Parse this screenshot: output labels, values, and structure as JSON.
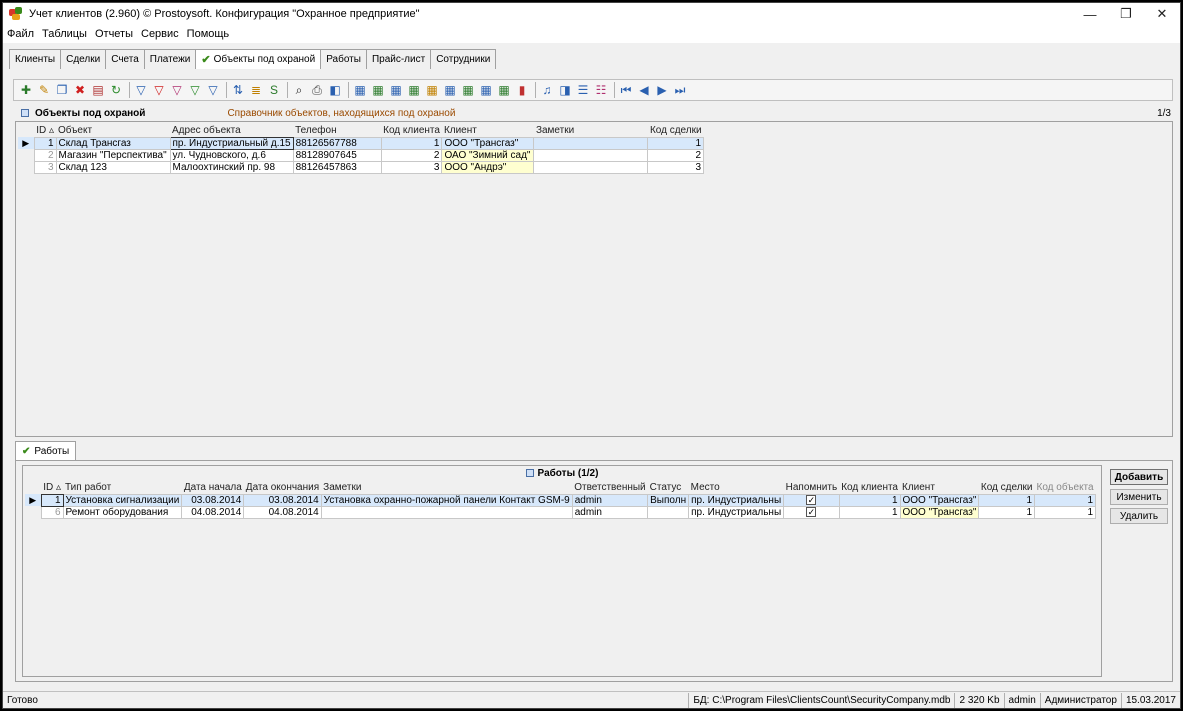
{
  "window": {
    "title": "Учет клиентов (2.960) © Prostoysoft. Конфигурация \"Охранное предприятие\"",
    "controls": [
      "—",
      "❐",
      "✕"
    ]
  },
  "menu": [
    "Файл",
    "Таблицы",
    "Отчеты",
    "Сервис",
    "Помощь"
  ],
  "tabs": [
    {
      "label": "Клиенты"
    },
    {
      "label": "Сделки"
    },
    {
      "label": "Счета"
    },
    {
      "label": "Платежи"
    },
    {
      "label": "Объекты под охраной",
      "active": true
    },
    {
      "label": "Работы"
    },
    {
      "label": "Прайс-лист"
    },
    {
      "label": "Сотрудники"
    }
  ],
  "toolbar_icons": [
    "add-record-icon",
    "edit-icon",
    "copy-icon",
    "delete-icon",
    "print-list-icon",
    "refresh-icon",
    "sep",
    "filter-icon",
    "filter-remove-icon",
    "filter-advanced-icon",
    "filter-field-icon",
    "filter-clear-icon",
    "sep",
    "sort-icon",
    "group-icon",
    "sql-icon",
    "sep",
    "find-icon",
    "print-icon",
    "preview-icon",
    "sep",
    "export-icon",
    "import-icon",
    "report-icon",
    "report2-icon",
    "report3-icon",
    "report4-icon",
    "report5-icon",
    "report6-icon",
    "report7-icon",
    "chart-icon",
    "sep",
    "note-icon",
    "attach-icon",
    "list-icon",
    "memo-icon",
    "sep",
    "first-icon",
    "prev-icon",
    "next-icon",
    "last-icon"
  ],
  "objects_panel": {
    "title": "Объекты под охраной",
    "description": "Справочник объектов, находящихся под охраной",
    "counter": "1/3",
    "columns": [
      "ID",
      "Объект",
      "Адрес объекта",
      "Телефон",
      "Код клиента",
      "Клиент",
      "Заметки",
      "Код сделки"
    ],
    "rows": [
      {
        "id": "1",
        "object": "Склад Трансгаз",
        "address": "пр. Индустриальный д.15",
        "phone": "88126567788",
        "client_code": "1",
        "client": "ООО \"Трансгаз\"",
        "notes": "",
        "deal_code": "1"
      },
      {
        "id": "2",
        "object": "Магазин \"Перспектива\"",
        "address": "ул. Чудновского, д.6",
        "phone": "88128907645",
        "client_code": "2",
        "client": "ОАО \"Зимний сад\"",
        "notes": "",
        "deal_code": "2"
      },
      {
        "id": "3",
        "object": "Склад 123",
        "address": "Малоохтинский пр. 98",
        "phone": "88126457863",
        "client_code": "3",
        "client": "ООО \"Андрэ\"",
        "notes": "",
        "deal_code": "3"
      }
    ]
  },
  "works_tab": {
    "label": "Работы"
  },
  "works_panel": {
    "title": "Работы (1/2)",
    "columns": [
      "ID",
      "Тип работ",
      "Дата начала",
      "Дата окончания",
      "Заметки",
      "Ответственный",
      "Статус",
      "Место",
      "Напомнить",
      "Код клиента",
      "Клиент",
      "Код сделки",
      "Код объекта"
    ],
    "rows": [
      {
        "id": "1",
        "type": "Установка сигнализации",
        "start": "03.08.2014",
        "end": "03.08.2014",
        "notes": "Установка охранно-пожарной панели Контакт GSM-9",
        "responsible": "admin",
        "status": "Выполн",
        "place": "пр. Индустриальны",
        "remind": true,
        "client_code": "1",
        "client": "ООО \"Трансгаз\"",
        "deal_code": "1",
        "object_code": "1"
      },
      {
        "id": "6",
        "type": "Ремонт оборудования",
        "start": "04.08.2014",
        "end": "04.08.2014",
        "notes": "",
        "responsible": "admin",
        "status": "",
        "place": "пр. Индустриальны",
        "remind": true,
        "client_code": "1",
        "client": "ООО \"Трансгаз\"",
        "deal_code": "1",
        "object_code": "1"
      }
    ],
    "buttons": {
      "add": "Добавить",
      "edit": "Изменить",
      "delete": "Удалить"
    }
  },
  "statusbar": {
    "ready": "Готово",
    "db_label": "БД:",
    "db_path": "C:\\Program Files\\ClientsCount\\SecurityCompany.mdb",
    "db_size": "2 320 Kb",
    "user": "admin",
    "role": "Администратор",
    "date": "15.03.2017"
  },
  "colors": {
    "selected_row": "#d7e8fb",
    "client_cell": "#ffffd0",
    "accent_check": "#3a8a1a",
    "desc_text": "#9a4a00"
  }
}
